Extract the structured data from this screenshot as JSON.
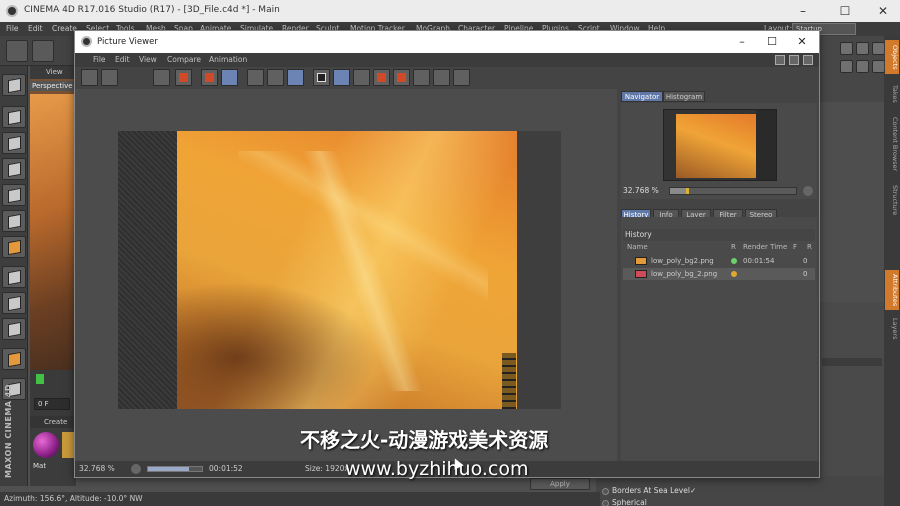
{
  "app": {
    "title": "CINEMA 4D R17.016 Studio (R17) - [3D_File.c4d *] - Main",
    "window_controls": [
      "–",
      "☐",
      "✕"
    ]
  },
  "menubar": {
    "items": [
      "File",
      "Edit",
      "Create",
      "Select",
      "Tools",
      "Mesh",
      "Snap",
      "Animate",
      "Simulate",
      "Render",
      "Sculpt",
      "Motion Tracker",
      "MoGraph",
      "Character",
      "Pipeline",
      "Plugins",
      "Script",
      "Window",
      "Help"
    ],
    "layout_label": "Layout:",
    "layout_value": "Startup"
  },
  "viewport": {
    "menu_label": "View",
    "camera_label": "Perspective"
  },
  "timeline": {
    "frame_field": "0 F"
  },
  "material_manager": {
    "header": "Create",
    "material_name": "Mat"
  },
  "logo_text": "MAXON CINEMA 4D",
  "statusbar": {
    "text": "Azimuth: 156.6°, Altitude: -10.0°  NW"
  },
  "right_tabs": [
    "Objects",
    "Takes",
    "Content Browser",
    "Structure",
    "Attributes",
    "Layers"
  ],
  "attributes_bottom": {
    "row1": "Borders At Sea Level",
    "row1_check": "✓",
    "row2": "Spherical",
    "apply_label": "Apply"
  },
  "picture_viewer": {
    "title": "Picture Viewer",
    "window_controls": [
      "–",
      "☐",
      "✕"
    ],
    "menu": [
      "File",
      "Edit",
      "View",
      "Compare",
      "Animation"
    ],
    "status": {
      "zoom": "32.768 %",
      "time": "00:01:52",
      "size": "Size: 1920x",
      "progress": 0.75
    },
    "side_tabs_top": [
      "Navigator",
      "Histogram"
    ],
    "nav_zoom": "32.768 %",
    "side_tabs_bottom": [
      "History",
      "Info",
      "Layer",
      "Filter",
      "Stereo"
    ],
    "history": {
      "header": "History",
      "columns": [
        "Name",
        "R",
        "Render Time",
        "F",
        "R"
      ],
      "rows": [
        {
          "name": "low_poly_bg2.png",
          "status_color": "#6ad06a",
          "time": "00:01:54",
          "frame": "0"
        },
        {
          "name": "low_poly_bg_2.png",
          "status_color": "#e0a830",
          "time": "",
          "frame": "0"
        }
      ]
    }
  },
  "watermark": {
    "line1": "不移之火-动漫游戏美术资源",
    "line2": "www.byzhihuo.com"
  }
}
